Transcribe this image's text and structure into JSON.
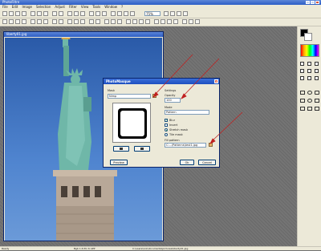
{
  "app": {
    "title": "PhotoFiltre"
  },
  "menu": [
    "File",
    "Edit",
    "Image",
    "Selection",
    "Adjust",
    "Filter",
    "View",
    "Tools",
    "Window",
    "?"
  ],
  "toolbar": {
    "zoom": "75%"
  },
  "document": {
    "title": "liberty01.jpg"
  },
  "dialog": {
    "title": "PhotoMasque",
    "close_label": "x",
    "mask_section": "Mask",
    "mask_file": "Nimp",
    "settings_section": "Settings",
    "opacity_label": "Opacity",
    "opacity_value": "100",
    "mode_label": "Mode",
    "mode_value": "Pattern",
    "blur_label": "Blur",
    "stretch_label": "Stretch mask",
    "invert_label": "Invert",
    "tile_label": "Tile mask",
    "fill_pattern_label": "Fill pattern",
    "fill_pattern_value": "C:...\\Patterns\\test1.jpg",
    "preview_label": "Preview",
    "ok_label": "Ok",
    "cancel_label": "Cancel"
  },
  "status": {
    "state": "Ready",
    "size": "Bgb 1.6 Pix 6 APP",
    "path": "C:\\users\\xxx\\documents\\pictures\\liberty01.jpg"
  },
  "colors": {
    "xp_titlebar": "#2c5cc5",
    "chrome": "#ece9d8",
    "sky": "#2a5aa8",
    "statue": "#6fb7a8",
    "arrow": "#c02020"
  }
}
